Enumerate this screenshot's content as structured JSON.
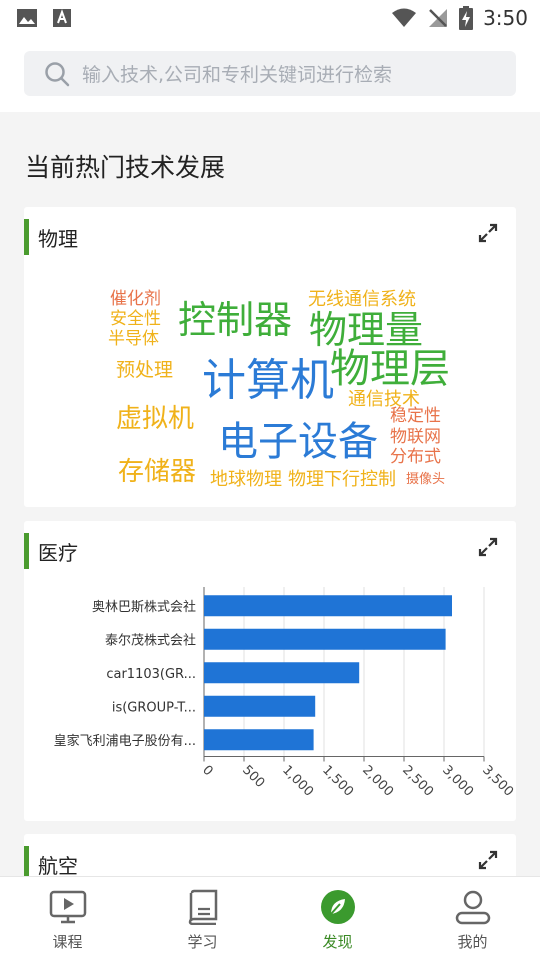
{
  "status": {
    "time": "3:50"
  },
  "search": {
    "placeholder": "输入技术,公司和专利关键词进行检索"
  },
  "section_title": "当前热门技术发展",
  "cards": [
    {
      "title": "物理",
      "words": [
        {
          "text": "催化剂",
          "color": "#e8734a"
        },
        {
          "text": "安全性",
          "color": "#f0b21a"
        },
        {
          "text": "半导体",
          "color": "#f0b21a"
        },
        {
          "text": "控制器",
          "color": "#3fae3a"
        },
        {
          "text": "无线通信系统",
          "color": "#f0b21a"
        },
        {
          "text": "物理量",
          "color": "#3fae3a"
        },
        {
          "text": "预处理",
          "color": "#f0b21a"
        },
        {
          "text": "计算机",
          "color": "#2b7bd6"
        },
        {
          "text": "物理层",
          "color": "#3fae3a"
        },
        {
          "text": "通信技术",
          "color": "#f0b21a"
        },
        {
          "text": "稳定性",
          "color": "#e8734a"
        },
        {
          "text": "虚拟机",
          "color": "#f0b21a"
        },
        {
          "text": "电子设备",
          "color": "#2b7bd6"
        },
        {
          "text": "物联网",
          "color": "#e8734a"
        },
        {
          "text": "分布式",
          "color": "#e8734a"
        },
        {
          "text": "存储器",
          "color": "#f0b21a"
        },
        {
          "text": "地球物理",
          "color": "#f0b21a"
        },
        {
          "text": "物理下行控制",
          "color": "#f0b21a"
        },
        {
          "text": "摄像头",
          "color": "#e8734a"
        }
      ]
    },
    {
      "title": "医疗",
      "chart_data": {
        "type": "bar",
        "orientation": "horizontal",
        "categories": [
          "奥林巴斯株式会社",
          "泰尔茂株式会社",
          "car1103(GR...",
          "is(GROUP-T...",
          "皇家飞利浦电子股份有..."
        ],
        "values": [
          3100,
          3020,
          1940,
          1390,
          1370
        ],
        "xlim": [
          0,
          3500
        ],
        "xticks": [
          "0",
          "500",
          "1,000",
          "1,500",
          "2,000",
          "2,500",
          "3,000",
          "3,500"
        ],
        "bar_color": "#1f74d6",
        "grid": true
      }
    },
    {
      "title": "航空"
    }
  ],
  "nav": [
    {
      "label": "课程",
      "icon": "video-lesson-icon"
    },
    {
      "label": "学习",
      "icon": "book-icon"
    },
    {
      "label": "发现",
      "icon": "compass-leaf-icon",
      "active": true
    },
    {
      "label": "我的",
      "icon": "user-icon"
    }
  ]
}
